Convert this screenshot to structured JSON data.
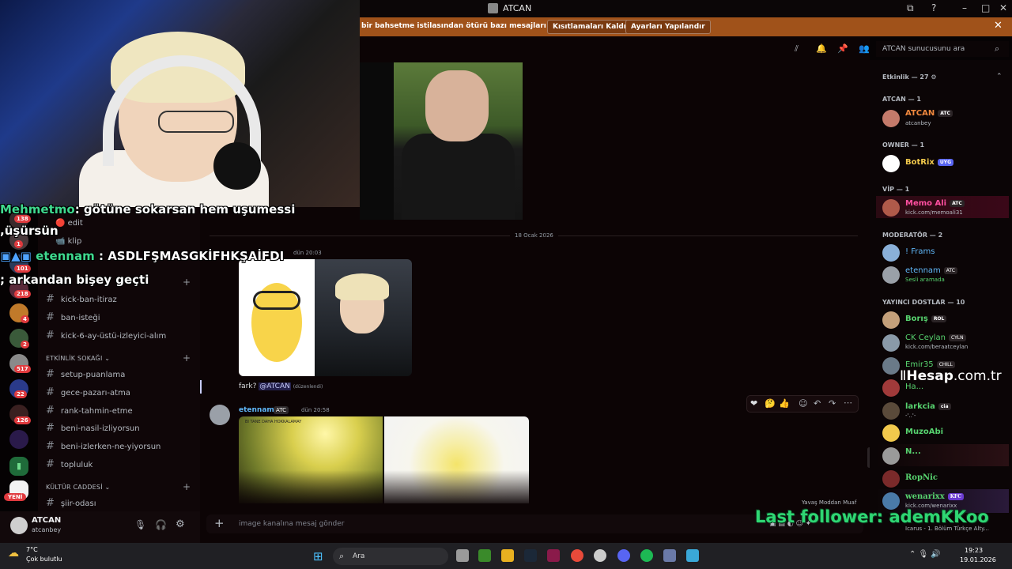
{
  "window": {
    "title": "ATCAN"
  },
  "notice": {
    "text": "bir bahsetme istilasından ötürü bazı mesajları kısıtlıyoruz",
    "btn_remove": "Kısıtlamaları Kaldır",
    "btn_settings": "Ayarları Yapılandır"
  },
  "overlay_chat": [
    {
      "name": "Mehmetmo",
      "text": ": götüne sokarsan hem uşumessi"
    },
    {
      "name": "",
      "text": ",üşürsün"
    },
    {
      "name": "etennam",
      "text": " : ASDLFŞMASGKİFHKŞAİFDI"
    },
    {
      "name": "",
      "text": "; arkandan bişey geçti"
    }
  ],
  "rail_badges": [
    "138",
    "1",
    "101",
    "218",
    "4",
    "2",
    "517",
    "22",
    "126"
  ],
  "rail_new_label": "YENİ",
  "channels": {
    "top": [
      {
        "icon": "🔴",
        "name": "edit"
      },
      {
        "icon": "📹",
        "name": "klip"
      }
    ],
    "group1": [
      "kick-ban-itiraz",
      "ban-isteği",
      "kick-6-ay-üstü-izleyici-alım"
    ],
    "cat_events": "ETKİNLİK SOKAĞI",
    "group2": [
      "setup-puanlama",
      "gece-pazarı-atma",
      "rank-tahmin-etme",
      "beni-nasil-izliyorsun",
      "beni-izlerken-ne-yiyorsun",
      "topluluk"
    ],
    "cat_culture": "KÜLTÜR CADDESİ",
    "group3": [
      "şiir-odası"
    ]
  },
  "user_panel": {
    "name": "ATCAN",
    "status": "atcanbey"
  },
  "chat": {
    "date_divider": "18 Ocak 2026",
    "msg1_time": "dün 20:03",
    "msg1_text": "fark? ",
    "msg1_mention": "@ATCAN",
    "msg1_edited": "(düzenlendi)",
    "msg2_author": "etennam",
    "msg2_badge": "ATC",
    "msg2_time": "dün 20:58",
    "img2a_caption": "BI TANE DAHA HOKKALAMAY",
    "composer_placeholder": "image kanalına mesaj gönder",
    "slowmode": "Yavaş Moddan Muaf"
  },
  "members": {
    "search_placeholder": "ATCAN sunucusunu ara",
    "activity_header": "Etkinlik — 27",
    "groups": [
      {
        "title": "ATCAN — 1",
        "members": [
          {
            "name": "ATCAN",
            "tag": "ATC",
            "sub": "atcanbey",
            "color": "#f0883e"
          }
        ]
      },
      {
        "title": "OWNER — 1",
        "members": [
          {
            "name": "BotRix",
            "tag": "UYG",
            "sub": "",
            "color": "#f2c94c"
          }
        ]
      },
      {
        "title": "VİP — 1",
        "members": [
          {
            "name": "Memo Ali",
            "tag": "ATC",
            "sub": "kick.com/memoali31",
            "color": "#ff4fa0"
          }
        ]
      },
      {
        "title": "MODERATÖR — 2",
        "members": [
          {
            "name": "! Frams",
            "tag": "",
            "sub": "",
            "color": "#5fb6f7"
          },
          {
            "name": "etennam",
            "tag": "ATC",
            "sub": "Sesli aramada",
            "color": "#5fb6f7"
          }
        ]
      },
      {
        "title": "YAYINCI DOSTLAR — 10",
        "members": [
          {
            "name": "Borış",
            "tag": "ROL",
            "sub": "",
            "color": "#57d36f"
          },
          {
            "name": "CK Ceylan",
            "tag": "CYLN",
            "sub": "kick.com/beraatceylan",
            "color": "#57d36f"
          },
          {
            "name": "Emir35",
            "tag": "CHILL",
            "sub": "",
            "color": "#57d36f"
          },
          {
            "name": "Ha...",
            "tag": "",
            "sub": "",
            "color": "#57d36f"
          },
          {
            "name": "larkcia",
            "tag": "cia",
            "sub": "-'..'-",
            "color": "#57d36f"
          },
          {
            "name": "MuzoAbi",
            "tag": "",
            "sub": "",
            "color": "#57d36f"
          },
          {
            "name": "N...",
            "tag": "",
            "sub": "",
            "color": "#57d36f"
          },
          {
            "name": "RopNic",
            "tag": "",
            "sub": "",
            "color": "#57d36f"
          },
          {
            "name": "wenarixx",
            "tag": "KFC",
            "sub": "kick.com/wenarixx",
            "color": "#57d36f"
          },
          {
            "name": "",
            "tag": "",
            "sub": "Icarus - 1. Bölüm Türkçe Alty...",
            "color": "#57d36f"
          }
        ]
      }
    ]
  },
  "watermark": {
    "brand": "Hesap",
    "domain": ".com.tr"
  },
  "last_follower": "Last follower: ademKKoo",
  "taskbar": {
    "weather_temp": "7°C",
    "weather_desc": "Çok bulutlu",
    "search": "Ara",
    "time": "19:23",
    "date": "19.01.2026"
  },
  "colors": {
    "notice_bg": "#a0521a",
    "accent": "#5865f2",
    "follower_green": "#2fd673"
  }
}
